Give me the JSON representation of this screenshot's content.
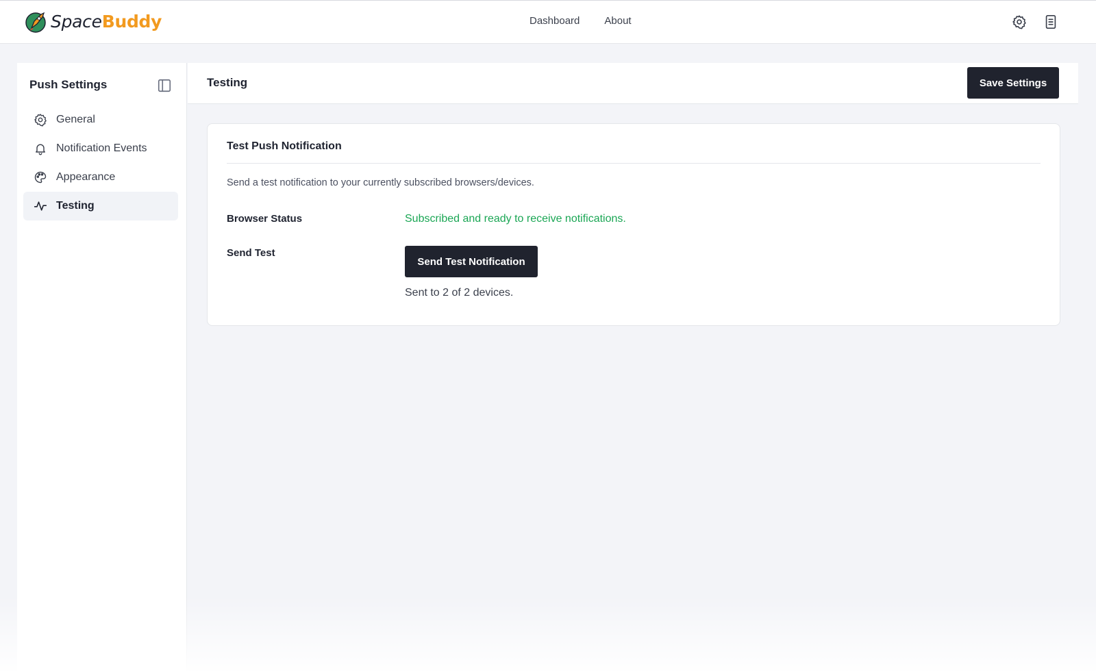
{
  "app": {
    "logo_part1": "Space",
    "logo_part2": "Buddy",
    "brand_color": "#f29a1f"
  },
  "topnav": {
    "items": [
      "Dashboard",
      "About"
    ],
    "icons": [
      "gear-icon",
      "document-icon"
    ]
  },
  "sidebar": {
    "title": "Push Settings",
    "items": [
      {
        "label": "General",
        "icon": "gear-icon",
        "active": false
      },
      {
        "label": "Notification Events",
        "icon": "bell-icon",
        "active": false
      },
      {
        "label": "Appearance",
        "icon": "palette-icon",
        "active": false
      },
      {
        "label": "Testing",
        "icon": "activity-icon",
        "active": true
      }
    ]
  },
  "main": {
    "title": "Testing",
    "save_label": "Save Settings"
  },
  "card": {
    "title": "Test Push Notification",
    "description": "Send a test notification to your currently subscribed browsers/devices.",
    "browser_status_label": "Browser Status",
    "browser_status_value": "Subscribed and ready to receive notifications.",
    "send_test_label": "Send Test",
    "send_button": "Send Test Notification",
    "result": "Sent to 2 of 2 devices."
  },
  "colors": {
    "success": "#1aa654",
    "button_dark": "#20232e"
  }
}
